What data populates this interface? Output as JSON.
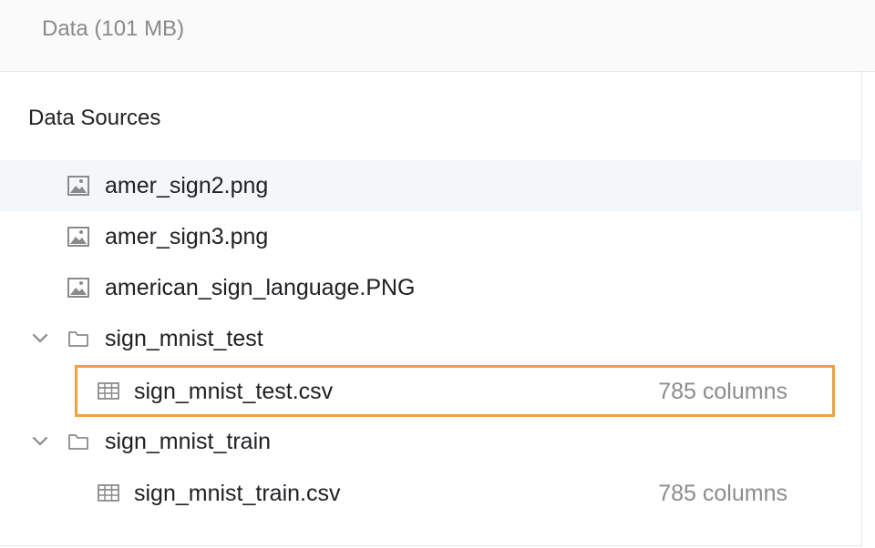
{
  "header": {
    "title": "Data (101 MB)"
  },
  "sources": {
    "title": "Data Sources",
    "items": [
      {
        "name": "amer_sign2.png",
        "icon": "image-icon"
      },
      {
        "name": "amer_sign3.png",
        "icon": "image-icon"
      },
      {
        "name": "american_sign_language.PNG",
        "icon": "image-icon"
      },
      {
        "name": "sign_mnist_test",
        "icon": "folder-icon",
        "expanded": true
      },
      {
        "name": "sign_mnist_test.csv",
        "icon": "table-icon",
        "meta": "785 columns",
        "selected": true
      },
      {
        "name": "sign_mnist_train",
        "icon": "folder-icon",
        "expanded": true
      },
      {
        "name": "sign_mnist_train.csv",
        "icon": "table-icon",
        "meta": "785 columns"
      }
    ]
  },
  "colors": {
    "highlight": "#f0a040",
    "hover_row": "#f4f7fa",
    "muted_text": "#8c8c8c"
  }
}
